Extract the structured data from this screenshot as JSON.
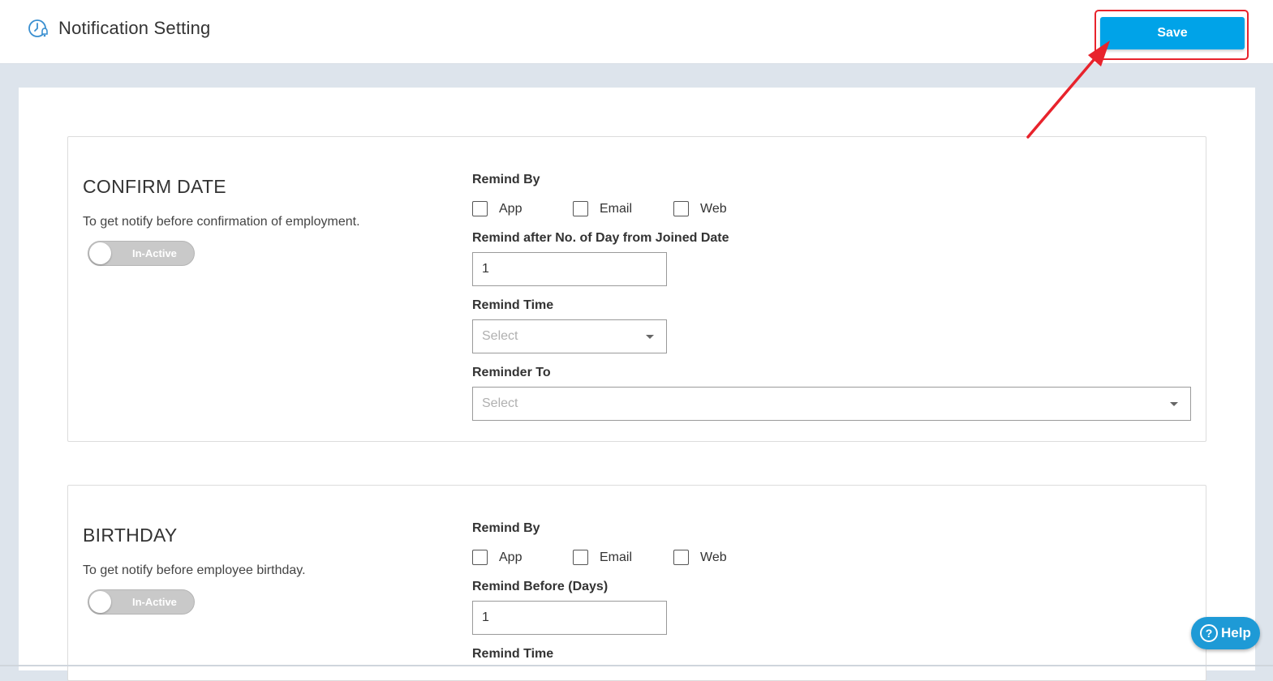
{
  "header": {
    "title": "Notification Setting",
    "icon": "clock-bell-icon",
    "save_label": "Save"
  },
  "sections": [
    {
      "title": "CONFIRM DATE",
      "description": "To get notify before confirmation of employment.",
      "toggle_label": "In-Active",
      "remind_by_label": "Remind By",
      "channels": [
        {
          "label": "App",
          "checked": false
        },
        {
          "label": "Email",
          "checked": false
        },
        {
          "label": "Web",
          "checked": false
        }
      ],
      "days_label": "Remind after No. of Day from Joined Date",
      "days_value": "1",
      "time_label": "Remind Time",
      "time_placeholder": "Select",
      "to_label": "Reminder To",
      "to_placeholder": "Select"
    },
    {
      "title": "BIRTHDAY",
      "description": "To get notify before employee birthday.",
      "toggle_label": "In-Active",
      "remind_by_label": "Remind By",
      "channels": [
        {
          "label": "App",
          "checked": false
        },
        {
          "label": "Email",
          "checked": false
        },
        {
          "label": "Web",
          "checked": false
        }
      ],
      "days_label": "Remind Before (Days)",
      "days_value": "1",
      "time_label": "Remind Time"
    }
  ],
  "help": {
    "label": "Help",
    "icon_glyph": "?"
  },
  "colors": {
    "accent": "#00a3e8",
    "highlight": "#e8232c",
    "help": "#1e9ad6"
  }
}
